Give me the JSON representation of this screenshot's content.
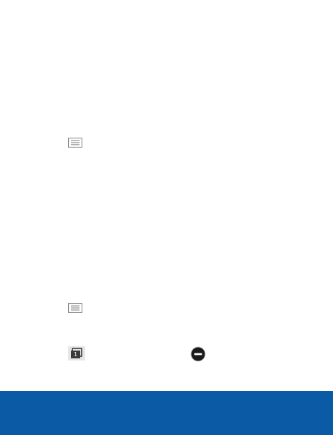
{
  "colors": {
    "brand_bar": "#0b5aa6",
    "icon_gray": "#8c8c8c",
    "icon_dark": "#3a3a3a",
    "icon_bg": "#e6e6e6"
  },
  "icons": {
    "menu_top": "menu-icon",
    "menu_bottom": "menu-icon",
    "tabs": "window-tabs-icon",
    "remove": "remove-circle-icon"
  },
  "tabs_icon": {
    "count": "1"
  }
}
